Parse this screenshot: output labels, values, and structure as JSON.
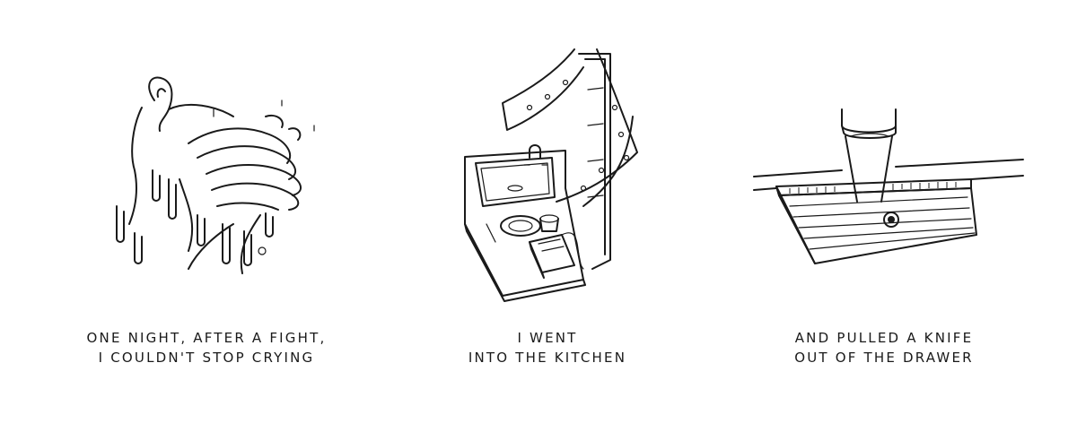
{
  "panels": [
    {
      "caption_lines": [
        "One night, after a fight,",
        "I couldn't stop crying"
      ]
    },
    {
      "caption_lines": [
        "I went",
        "into the kitchen"
      ]
    },
    {
      "caption_lines": [
        "And pulled a knife",
        "out of the drawer"
      ]
    }
  ],
  "colors": {
    "ink": "#1a1a1a",
    "paper": "#ffffff"
  }
}
